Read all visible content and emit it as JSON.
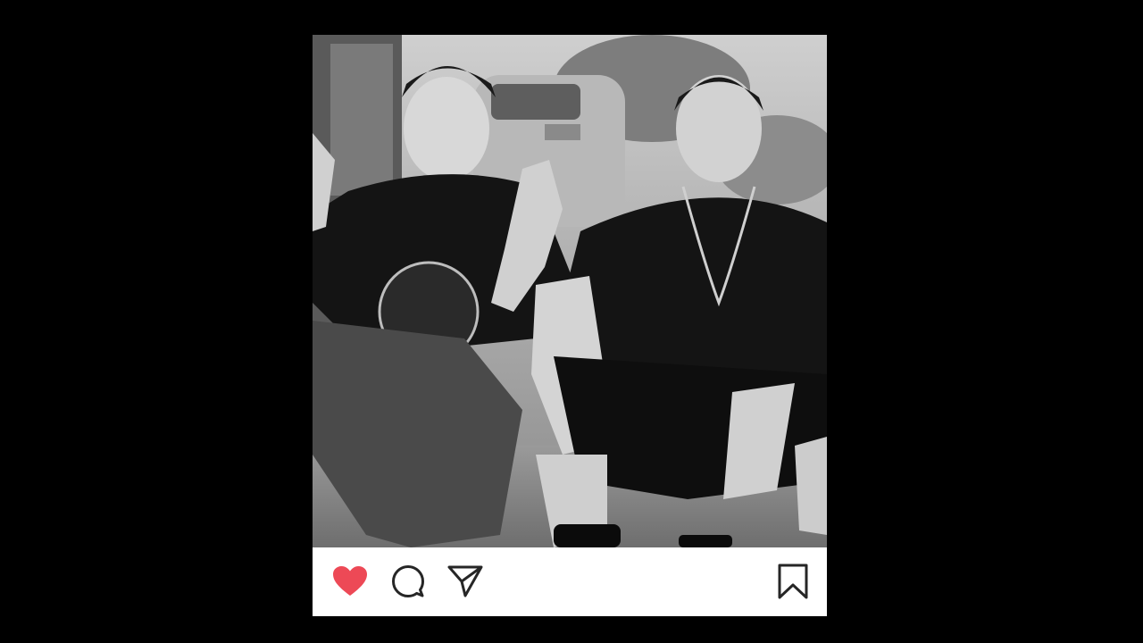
{
  "post": {
    "photo_alt": "",
    "liked": true
  },
  "actions": {
    "like_icon": "heart-filled-icon",
    "comment_icon": "comment-bubble-icon",
    "share_icon": "paper-plane-icon",
    "save_icon": "bookmark-icon"
  },
  "colors": {
    "background": "#000000",
    "card": "#ffffff",
    "heart": "#ed4956",
    "icon_stroke": "#262626"
  }
}
